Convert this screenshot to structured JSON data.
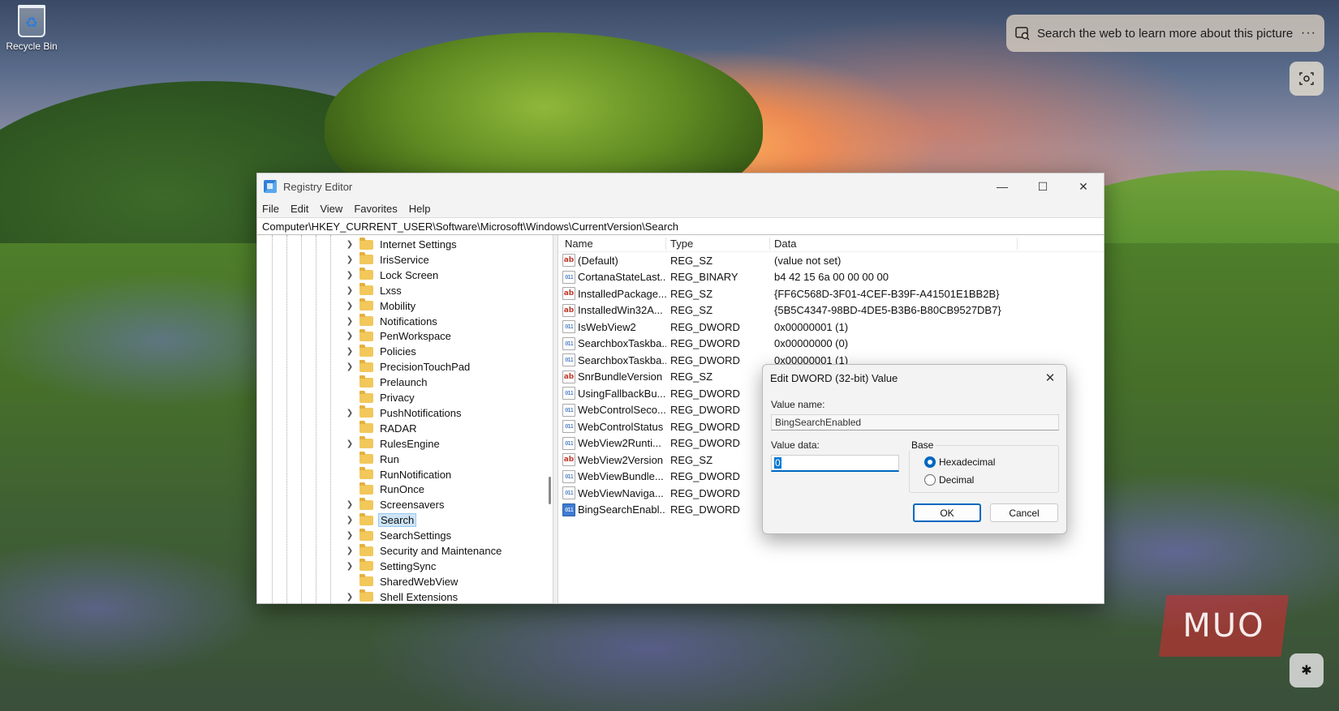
{
  "desktop": {
    "recycle_bin_label": "Recycle Bin",
    "visual_search_text": "Search the web to learn more about this picture",
    "visual_search_more": "···",
    "watermark": "MUO"
  },
  "window": {
    "title": "Registry Editor",
    "controls": {
      "minimize": "—",
      "maximize": "☐",
      "close": "✕"
    },
    "menu": [
      "File",
      "Edit",
      "View",
      "Favorites",
      "Help"
    ],
    "address": "Computer\\HKEY_CURRENT_USER\\Software\\Microsoft\\Windows\\CurrentVersion\\Search"
  },
  "tree": {
    "items": [
      {
        "label": "Internet Settings",
        "expandable": true
      },
      {
        "label": "IrisService",
        "expandable": true
      },
      {
        "label": "Lock Screen",
        "expandable": true
      },
      {
        "label": "Lxss",
        "expandable": true
      },
      {
        "label": "Mobility",
        "expandable": true
      },
      {
        "label": "Notifications",
        "expandable": true
      },
      {
        "label": "PenWorkspace",
        "expandable": true
      },
      {
        "label": "Policies",
        "expandable": true
      },
      {
        "label": "PrecisionTouchPad",
        "expandable": true
      },
      {
        "label": "Prelaunch",
        "expandable": false
      },
      {
        "label": "Privacy",
        "expandable": false
      },
      {
        "label": "PushNotifications",
        "expandable": true
      },
      {
        "label": "RADAR",
        "expandable": false
      },
      {
        "label": "RulesEngine",
        "expandable": true
      },
      {
        "label": "Run",
        "expandable": false
      },
      {
        "label": "RunNotification",
        "expandable": false
      },
      {
        "label": "RunOnce",
        "expandable": false
      },
      {
        "label": "Screensavers",
        "expandable": true
      },
      {
        "label": "Search",
        "expandable": true,
        "selected": true
      },
      {
        "label": "SearchSettings",
        "expandable": true
      },
      {
        "label": "Security and Maintenance",
        "expandable": true
      },
      {
        "label": "SettingSync",
        "expandable": true
      },
      {
        "label": "SharedWebView",
        "expandable": false
      },
      {
        "label": "Shell Extensions",
        "expandable": true
      }
    ]
  },
  "list": {
    "columns": {
      "name": "Name",
      "type": "Type",
      "data": "Data"
    },
    "rows": [
      {
        "name": "(Default)",
        "type": "REG_SZ",
        "data": "(value not set)",
        "icon": "ab"
      },
      {
        "name": "CortanaStateLast...",
        "type": "REG_BINARY",
        "data": "b4 42 15 6a 00 00 00 00",
        "icon": "bin"
      },
      {
        "name": "InstalledPackage...",
        "type": "REG_SZ",
        "data": "{FF6C568D-3F01-4CEF-B39F-A41501E1BB2B}",
        "icon": "ab"
      },
      {
        "name": "InstalledWin32A...",
        "type": "REG_SZ",
        "data": "{5B5C4347-98BD-4DE5-B3B6-B80CB9527DB7}",
        "icon": "ab"
      },
      {
        "name": "IsWebView2",
        "type": "REG_DWORD",
        "data": "0x00000001 (1)",
        "icon": "bin"
      },
      {
        "name": "SearchboxTaskba...",
        "type": "REG_DWORD",
        "data": "0x00000000 (0)",
        "icon": "bin"
      },
      {
        "name": "SearchboxTaskba...",
        "type": "REG_DWORD",
        "data": "0x00000001 (1)",
        "icon": "bin"
      },
      {
        "name": "SnrBundleVersion",
        "type": "REG_SZ",
        "data": "",
        "icon": "ab"
      },
      {
        "name": "UsingFallbackBu...",
        "type": "REG_DWORD",
        "data": "",
        "icon": "bin"
      },
      {
        "name": "WebControlSeco...",
        "type": "REG_DWORD",
        "data": "",
        "icon": "bin"
      },
      {
        "name": "WebControlStatus",
        "type": "REG_DWORD",
        "data": "",
        "icon": "bin"
      },
      {
        "name": "WebView2Runti...",
        "type": "REG_DWORD",
        "data": "",
        "icon": "bin"
      },
      {
        "name": "WebView2Version",
        "type": "REG_SZ",
        "data": "",
        "icon": "ab"
      },
      {
        "name": "WebViewBundle...",
        "type": "REG_DWORD",
        "data": "",
        "icon": "bin"
      },
      {
        "name": "WebViewNaviga...",
        "type": "REG_DWORD",
        "data": "",
        "icon": "bin"
      },
      {
        "name": "BingSearchEnabl...",
        "type": "REG_DWORD",
        "data": "",
        "icon": "bin",
        "highlight": true
      }
    ]
  },
  "dialog": {
    "title": "Edit DWORD (32-bit) Value",
    "close": "✕",
    "value_name_label": "Value name:",
    "value_name": "BingSearchEnabled",
    "value_data_label": "Value data:",
    "value_data": "0",
    "base_label": "Base",
    "hex_label": "Hexadecimal",
    "dec_label": "Decimal",
    "selected_base": "Hexadecimal",
    "ok_label": "OK",
    "cancel_label": "Cancel"
  },
  "colors": {
    "accent": "#0067c0",
    "selection": "#cde4f7",
    "folder": "#f2c85b"
  }
}
